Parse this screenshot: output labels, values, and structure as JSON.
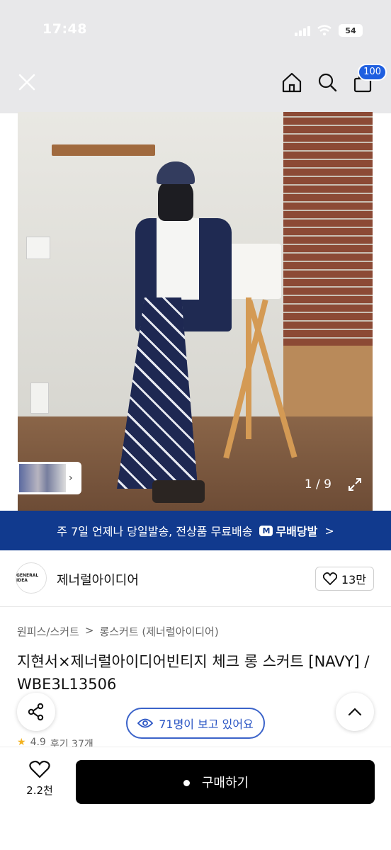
{
  "status": {
    "time": "17:48",
    "battery": "54"
  },
  "header": {
    "cart_count": "100"
  },
  "gallery": {
    "counter": "1 / 9"
  },
  "promo": {
    "text": "주 7일 언제나 당일발송, 전상품 무료배송",
    "badge_mark": "M",
    "badge_text": "무배당발",
    "arrow": ">"
  },
  "brand": {
    "logo_text": "GENERAL IDEA",
    "name": "제너럴아이디어",
    "likes": "13만"
  },
  "breadcrumb": {
    "category": "원피스/스커트",
    "sep": ">",
    "subcategory": "롱스커트 (제너럴아이디어)"
  },
  "product": {
    "title": "지현서×제너럴아이디어빈티지 체크 롱 스커트 [NAVY] / WBE3L13506"
  },
  "viewers": {
    "text": "71명이 보고 있어요"
  },
  "rating": {
    "score": "4.9",
    "reviews": "후기 37개"
  },
  "bottom": {
    "wish_count": "2.2천",
    "buy_label": "구매하기"
  },
  "colors": {
    "promo_bg": "#113a8e",
    "accent_blue": "#1f5fe0",
    "buy_bg": "#000000"
  }
}
